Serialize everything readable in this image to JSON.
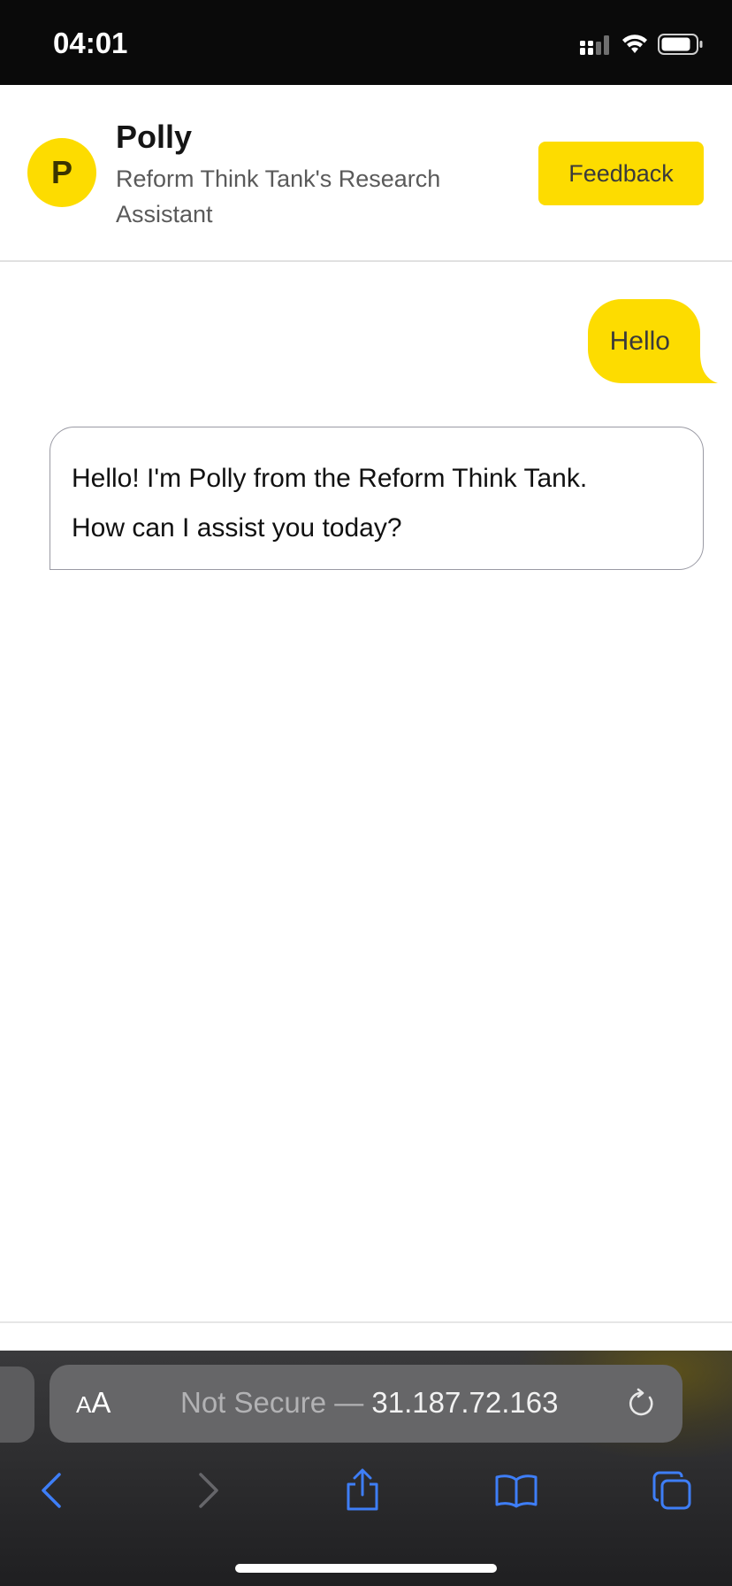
{
  "status_bar": {
    "time": "04:01",
    "icons": [
      "cellular-signal-icon",
      "wifi-icon",
      "battery-icon"
    ]
  },
  "header": {
    "avatar_letter": "P",
    "bot_name": "Polly",
    "bot_description": "Reform Think Tank's Research Assistant",
    "feedback_label": "Feedback"
  },
  "chat": {
    "messages": [
      {
        "role": "user",
        "text": "Hello"
      },
      {
        "role": "assistant",
        "lines": [
          "Hello! I'm Polly from the Reform Think Tank.",
          "How can I assist you today?"
        ]
      }
    ]
  },
  "browser": {
    "aa_small": "A",
    "aa_big": "A",
    "url_prefix": "Not Secure — ",
    "url_host": "31.187.72.163",
    "toolbar_icons": [
      "back-icon",
      "forward-icon",
      "share-icon",
      "bookmarks-icon",
      "tabs-icon"
    ]
  },
  "colors": {
    "accent": "#fddc00",
    "status_bar_bg": "#0a0a0a",
    "browser_bar_bg": "#2c2c2e",
    "browser_icon_blue": "#3e7ef7"
  }
}
